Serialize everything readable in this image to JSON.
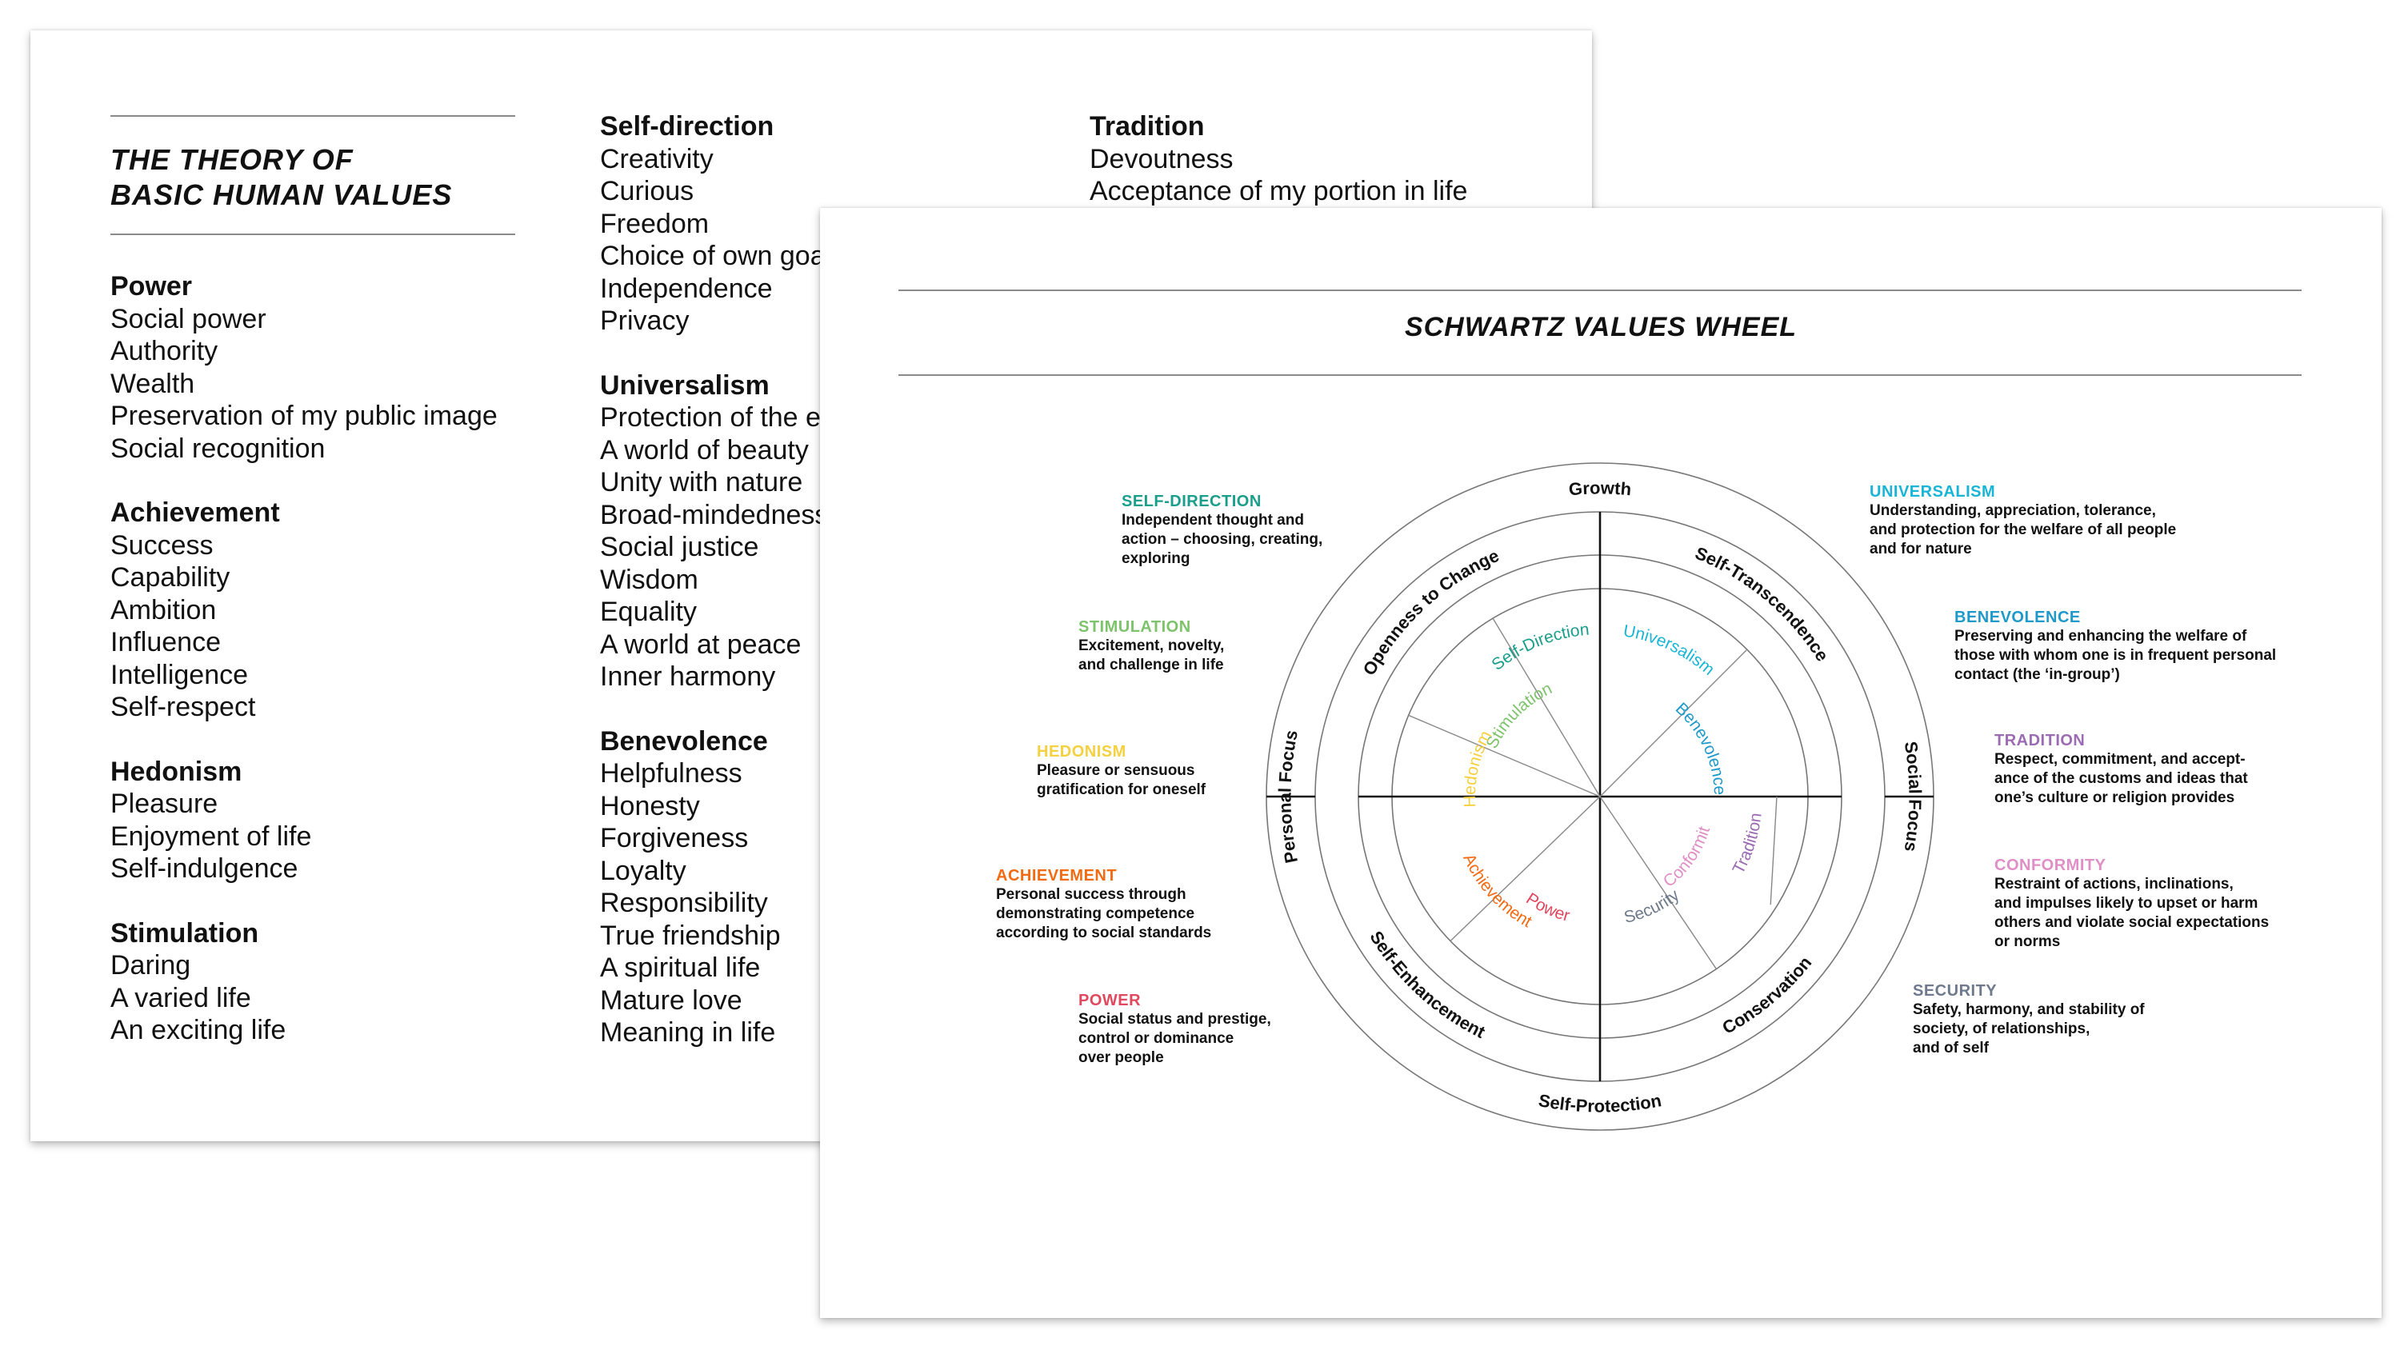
{
  "left_card": {
    "title_line1": "THE THEORY OF",
    "title_line2": "BASIC HUMAN VALUES",
    "columns": [
      [
        {
          "heading": "Power",
          "items": [
            "Social power",
            "Authority",
            "Wealth",
            "Preservation of my public image",
            "Social recognition"
          ]
        },
        {
          "heading": "Achievement",
          "items": [
            "Success",
            "Capability",
            "Ambition",
            "Influence",
            "Intelligence",
            "Self-respect"
          ]
        },
        {
          "heading": "Hedonism",
          "items": [
            "Pleasure",
            "Enjoyment of life",
            "Self-indulgence"
          ]
        },
        {
          "heading": "Stimulation",
          "items": [
            "Daring",
            "A varied life",
            "An exciting life"
          ]
        }
      ],
      [
        {
          "heading": "Self-direction",
          "items": [
            "Creativity",
            "Curious",
            "Freedom",
            "Choice of own goals",
            "Independence",
            "Privacy"
          ]
        },
        {
          "heading": "Universalism",
          "items": [
            "Protection of the environment",
            "A world of beauty",
            "Unity with nature",
            "Broad-mindedness",
            "Social justice",
            "Wisdom",
            "Equality",
            "A world at peace",
            "Inner harmony"
          ]
        },
        {
          "heading": "Benevolence",
          "items": [
            "Helpfulness",
            "Honesty",
            "Forgiveness",
            "Loyalty",
            "Responsibility",
            "True friendship",
            "A spiritual life",
            "Mature love",
            "Meaning in life"
          ]
        }
      ],
      [
        {
          "heading": "Tradition",
          "items": [
            "Devoutness",
            "Acceptance of my portion in life"
          ]
        }
      ]
    ]
  },
  "right_card": {
    "title": "SCHWARTZ VALUES WHEEL",
    "descriptions": [
      {
        "key": "self_direction",
        "heading": "SELF-DIRECTION",
        "color": "#1a9e8c",
        "text": "Independent thought and\naction – choosing, creating,\nexploring"
      },
      {
        "key": "stimulation",
        "heading": "STIMULATION",
        "color": "#7dc36b",
        "text": "Excitement, novelty,\nand challenge in life"
      },
      {
        "key": "hedonism",
        "heading": "HEDONISM",
        "color": "#f5d03f",
        "text": "Pleasure or sensuous\ngratification for oneself"
      },
      {
        "key": "achievement",
        "heading": "ACHIEVEMENT",
        "color": "#f26a12",
        "text": "Personal success through\ndemonstrating competence\naccording to social standards"
      },
      {
        "key": "power",
        "heading": "POWER",
        "color": "#e0485f",
        "text": "Social status and prestige,\ncontrol or dominance\nover people"
      },
      {
        "key": "universalism",
        "heading": "UNIVERSALISM",
        "color": "#1ab5d6",
        "text": "Understanding, appreciation, tolerance,\nand protection for the welfare  of all people\nand for nature"
      },
      {
        "key": "benevolence",
        "heading": "BENEVOLENCE",
        "color": "#1f99c9",
        "text": "Preserving and enhancing the welfare of\nthose with whom one is in frequent personal\ncontact (the ‘in-group’)"
      },
      {
        "key": "tradition",
        "heading": "TRADITION",
        "color": "#9b6bb3",
        "text": "Respect, commitment, and accept-\nance of the customs and ideas that\none’s culture or religion provides"
      },
      {
        "key": "conformity",
        "heading": "CONFORMITY",
        "color": "#e08fc6",
        "text": "Restraint of actions, inclinations,\nand impulses likely to upset or harm\nothers and violate social expectations\nor norms"
      },
      {
        "key": "security",
        "heading": "SECURITY",
        "color": "#6e7a8c",
        "text": "Safety, harmony, and stability of\nsociety, of relationships,\nand of self"
      }
    ],
    "wheel": {
      "outer_labels": {
        "top": "Growth",
        "bottom": "Self-Protection",
        "left": "Personal Focus",
        "right": "Social Focus"
      },
      "middle_labels": {
        "top_left": "Openness to Change",
        "top_right": "Self-Transcendence",
        "bottom_left": "Self-Enhancement",
        "bottom_right": "Conservation"
      },
      "segments": [
        {
          "label": "Self-Direction",
          "color": "#1a9e8c"
        },
        {
          "label": "Universalism",
          "color": "#1ab5d6"
        },
        {
          "label": "Benevolence",
          "color": "#1f99c9"
        },
        {
          "label": "Stimulation",
          "color": "#7dc36b"
        },
        {
          "label": "Hedonism",
          "color": "#f5d03f"
        },
        {
          "label": "Achievement",
          "color": "#f26a12"
        },
        {
          "label": "Power",
          "color": "#e0485f"
        },
        {
          "label": "Security",
          "color": "#6e7a8c"
        },
        {
          "label": "Conformity",
          "color": "#e08fc6"
        },
        {
          "label": "Tradition",
          "color": "#9b6bb3"
        }
      ]
    }
  }
}
